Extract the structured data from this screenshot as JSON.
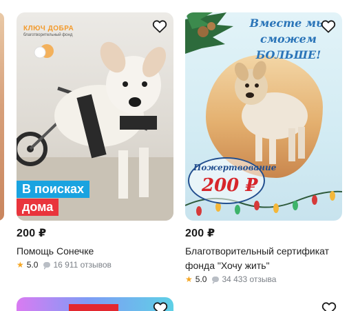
{
  "colors": {
    "price": "#1a1a1a",
    "star": "#f5a623",
    "muted": "#7a7f86",
    "badge_blue": "#1aa3e0",
    "badge_red": "#e9343c"
  },
  "cards": [
    {
      "price": "200 ₽",
      "title": "Помощь Сонечке",
      "rating": "5.0",
      "reviews": "16 911 отзывов",
      "image": {
        "brand_name": "КЛЮЧ ДОБРА",
        "brand_sub": "благотворительный фонд",
        "tag_line1": "В поисках",
        "tag_line2": "дома",
        "subject": "dog-in-wheelchair"
      },
      "favorite_icon": "heart-outline-icon"
    },
    {
      "price": "200 ₽",
      "title": "Благотворительный сертификат фонда \"Хочу жить\"",
      "rating": "5.0",
      "reviews": "34 433 отзыва",
      "image": {
        "slogan": "Вместе мы сможем БОЛЬШЕ!",
        "donation_label": "Пожертвование",
        "donation_amount": "200 ₽",
        "subject": "dog-on-orange-blob"
      },
      "favorite_icon": "heart-outline-icon"
    }
  ]
}
